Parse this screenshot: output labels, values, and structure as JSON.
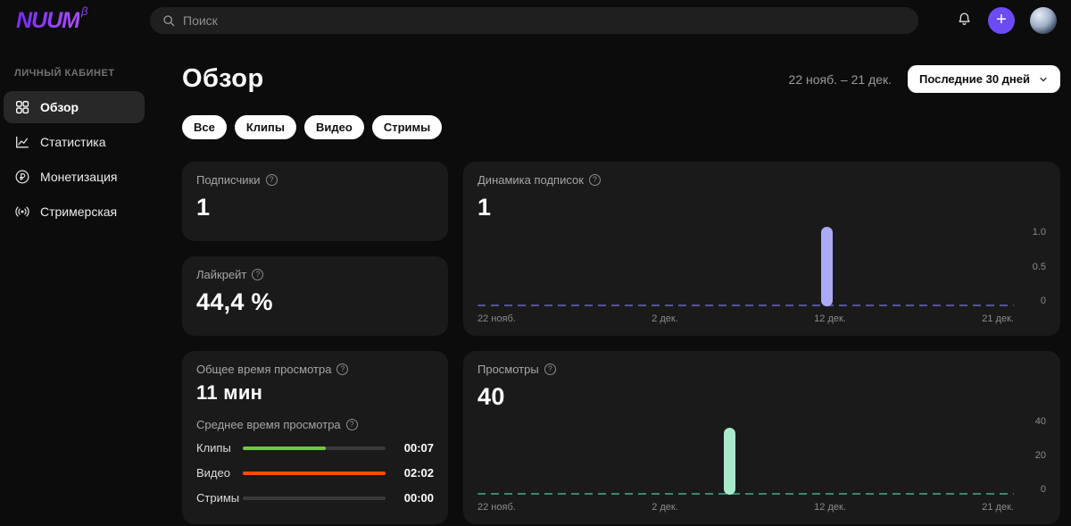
{
  "topbar": {
    "logo": "NUUM",
    "beta_badge": "β",
    "search_placeholder": "Поиск",
    "create_button": "+"
  },
  "sidebar": {
    "section_label": "ЛИЧНЫЙ КАБИНЕТ",
    "items": [
      {
        "label": "Обзор",
        "icon": "grid-icon",
        "active": true
      },
      {
        "label": "Статистика",
        "icon": "line-chart-icon",
        "active": false
      },
      {
        "label": "Монетизация",
        "icon": "ruble-coin-icon",
        "active": false
      },
      {
        "label": "Стримерская",
        "icon": "broadcast-icon",
        "active": false
      }
    ]
  },
  "header": {
    "title": "Обзор",
    "date_range": "22 нояб. – 21 дек.",
    "period_selector": "Последние 30 дней"
  },
  "filters": [
    {
      "label": "Все",
      "active": true
    },
    {
      "label": "Клипы",
      "active": false
    },
    {
      "label": "Видео",
      "active": false
    },
    {
      "label": "Стримы",
      "active": false
    }
  ],
  "icons": {
    "info": "?"
  },
  "colors": {
    "accent_purple": "#6C4BF4",
    "logo_purple": "#8B3CFF",
    "background": "#0C0C0C",
    "card": "#1A1A1A"
  },
  "cards": {
    "subscribers": {
      "title": "Подписчики",
      "value": "1"
    },
    "likerate": {
      "title": "Лайкрейт",
      "value": "44,4 %"
    },
    "watch_time": {
      "title": "Общее время просмотра",
      "value": "11 мин",
      "avg_title": "Среднее время просмотра",
      "rows": [
        {
          "label": "Клипы",
          "value": "00:07",
          "percent": 58,
          "color": "#6FC93C"
        },
        {
          "label": "Видео",
          "value": "02:02",
          "percent": 100,
          "color": "#FF4D00"
        },
        {
          "label": "Стримы",
          "value": "00:00",
          "percent": 0,
          "color": "#3A3A3A"
        }
      ]
    }
  },
  "chart_data": [
    {
      "type": "bar",
      "title": "Динамика подписок",
      "headline_value": "1",
      "x": [
        "22 нояб.",
        "2 дек.",
        "12 дек.",
        "21 дек."
      ],
      "yticks": [
        "1.0",
        "0.5",
        "0"
      ],
      "ylim": [
        0,
        1.0
      ],
      "grid": false,
      "legend_position": "none",
      "bar_color": "#ABAAF6",
      "baseline_color": "#55519E",
      "bars": [
        {
          "date": "10 дек.",
          "value": 1,
          "left_percent": 64,
          "height_percent": 100
        }
      ]
    },
    {
      "type": "bar",
      "title": "Просмотры",
      "headline_value": "40",
      "x": [
        "22 нояб.",
        "2 дек.",
        "12 дек.",
        "21 дек."
      ],
      "yticks": [
        "40",
        "20",
        "0"
      ],
      "ylim": [
        0,
        40
      ],
      "grid": false,
      "legend_position": "none",
      "bar_color": "#A9E9CB",
      "baseline_color": "#3F8572",
      "bars": [
        {
          "date": "5 дек.",
          "value": 35,
          "left_percent": 46,
          "height_percent": 85
        }
      ]
    }
  ]
}
